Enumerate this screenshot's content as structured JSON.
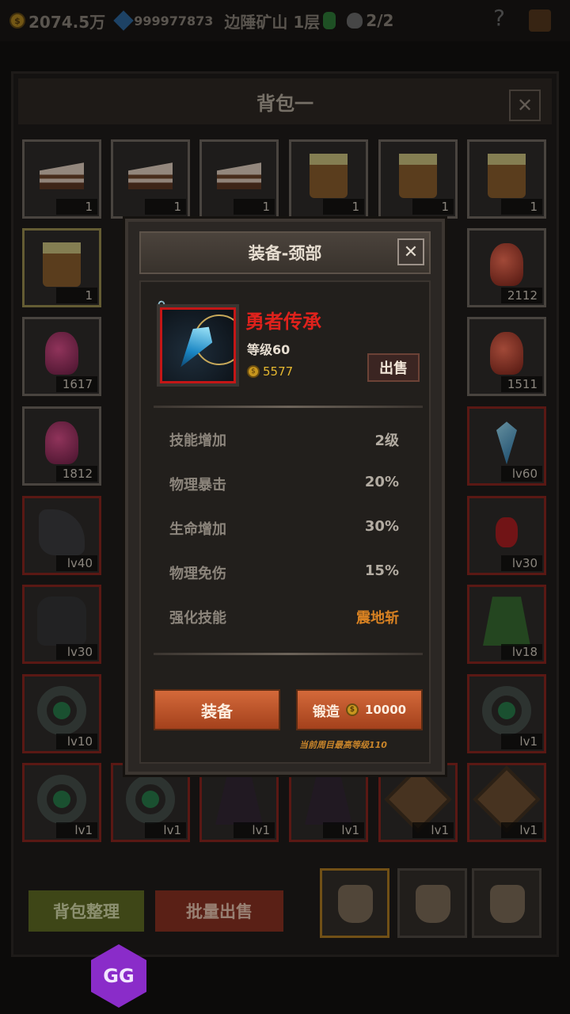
{
  "topbar": {
    "gold": "2074.5万",
    "gems": "999977873",
    "location": "边陲矿山 1层",
    "kills": "2/2",
    "help": "?"
  },
  "bag": {
    "title": "背包一",
    "close": "✕",
    "slots": [
      {
        "art": "cake",
        "count": "1",
        "border": "normal"
      },
      {
        "art": "cake",
        "count": "1",
        "border": "normal"
      },
      {
        "art": "cake",
        "count": "1",
        "border": "normal"
      },
      {
        "art": "mug",
        "count": "1",
        "border": "normal"
      },
      {
        "art": "mug",
        "count": "1",
        "border": "normal"
      },
      {
        "art": "mug",
        "count": "1",
        "border": "normal"
      },
      {
        "art": "mug",
        "count": "1",
        "border": "gold"
      },
      {
        "art": "potion-red",
        "count": "2112",
        "border": "normal"
      },
      {
        "art": "potion",
        "count": "1617",
        "border": "normal"
      },
      {
        "art": "potion-red",
        "count": "1511",
        "border": "normal"
      },
      {
        "art": "potion",
        "count": "1812",
        "border": "normal"
      },
      {
        "art": "pendant",
        "count": "lv60",
        "border": "red"
      },
      {
        "art": "glove",
        "count": "lv40",
        "border": "red"
      },
      {
        "art": "neck",
        "count": "lv30",
        "border": "red"
      },
      {
        "art": "armor",
        "count": "lv30",
        "border": "red"
      },
      {
        "art": "cape",
        "count": "lv18",
        "border": "red"
      },
      {
        "art": "ring",
        "count": "lv10",
        "border": "red"
      },
      {
        "art": "ring",
        "count": "lv1",
        "border": "red"
      },
      {
        "art": "ring",
        "count": "lv1",
        "border": "red"
      },
      {
        "art": "ring",
        "count": "lv1",
        "border": "red"
      },
      {
        "art": "robe",
        "count": "lv1",
        "border": "red"
      },
      {
        "art": "robe",
        "count": "lv1",
        "border": "red"
      },
      {
        "art": "shield",
        "count": "lv1",
        "border": "red"
      },
      {
        "art": "shield",
        "count": "lv1",
        "border": "red"
      }
    ],
    "sort_label": "背包整理",
    "bulk_sell_label": "批量出售"
  },
  "popup": {
    "title": "装备-颈部",
    "close": "✕",
    "item_name": "勇者传承",
    "item_level": "等级60",
    "item_price": "5577",
    "sell_label": "出售",
    "stats": [
      {
        "key": "技能增加",
        "value": "2级",
        "highlight": false
      },
      {
        "key": "物理暴击",
        "value": "20%",
        "highlight": false
      },
      {
        "key": "生命增加",
        "value": "30%",
        "highlight": false
      },
      {
        "key": "物理免伤",
        "value": "15%",
        "highlight": false
      },
      {
        "key": "强化技能",
        "value": "震地斩",
        "highlight": true
      }
    ],
    "equip_label": "装备",
    "forge_label": "锻造",
    "forge_cost": "10000",
    "note": "当前周目最高等级110"
  },
  "overlay": {
    "gg_label": "GG"
  },
  "colors": {
    "accent": "#c8561f",
    "item_name": "#e0221c",
    "highlight": "#d98222",
    "coin": "#e6b830"
  }
}
